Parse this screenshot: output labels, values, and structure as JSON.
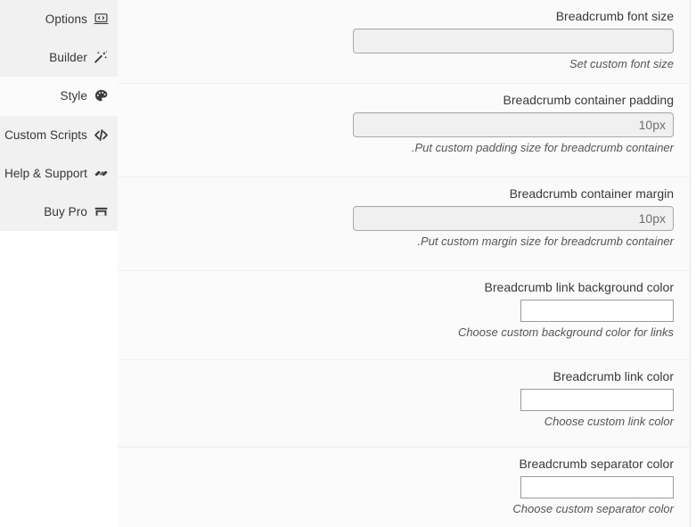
{
  "sidebar": {
    "items": [
      {
        "label": "Options",
        "icon": "laptop-code-icon",
        "active": false
      },
      {
        "label": "Builder",
        "icon": "magic-wand-icon",
        "active": false
      },
      {
        "label": "Style",
        "icon": "palette-icon",
        "active": true
      },
      {
        "label": "Custom Scripts",
        "icon": "code-tags-icon",
        "active": false
      },
      {
        "label": "Help & Support",
        "icon": "handshake-icon",
        "active": false
      },
      {
        "label": "Buy Pro",
        "icon": "store-icon",
        "active": false
      }
    ]
  },
  "form": {
    "fields": [
      {
        "label": "Breadcrumb font size",
        "control": "text",
        "value": "",
        "placeholder": "",
        "description": "Set custom font size"
      },
      {
        "label": "Breadcrumb container padding",
        "control": "text",
        "value": "",
        "placeholder": "10px",
        "description": ".Put custom padding size for breadcrumb container"
      },
      {
        "label": "Breadcrumb container margin",
        "control": "text",
        "value": "",
        "placeholder": "10px",
        "description": ".Put custom margin size for breadcrumb container"
      },
      {
        "label": "Breadcrumb link background color",
        "control": "color",
        "value": "",
        "placeholder": "",
        "description": "Choose custom background color for links"
      },
      {
        "label": "Breadcrumb link color",
        "control": "color",
        "value": "",
        "placeholder": "",
        "description": "Choose custom link color"
      },
      {
        "label": "Breadcrumb separator color",
        "control": "color",
        "value": "",
        "placeholder": "",
        "description": "Choose custom separator color"
      }
    ]
  },
  "colors": {
    "sidebar_bg": "#f1f1f1",
    "sidebar_active_bg": "#fbfbfb",
    "content_bg": "#fafafa",
    "label_text": "#3a3a3a",
    "desc_text": "#555555",
    "input_bg": "#f0f0f0",
    "input_border": "#a8a8a8",
    "color_input_bg": "#ffffff",
    "divider": "#eeeeee"
  }
}
